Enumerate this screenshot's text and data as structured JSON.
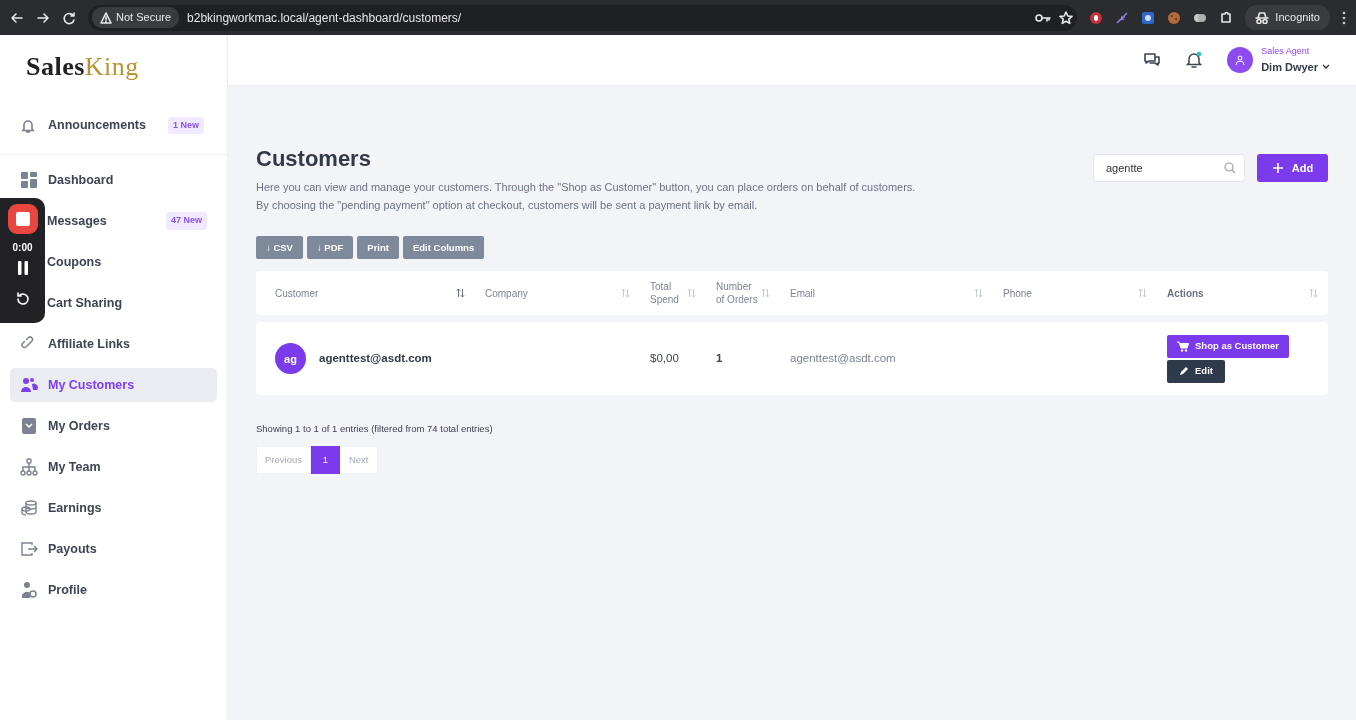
{
  "browser": {
    "security": "Not Secure",
    "url": "b2bkingworkmac.local/agent-dashboard/customers/",
    "profile": "Incognito"
  },
  "recorder": {
    "time": "0:00"
  },
  "sidebar": {
    "logo_left": "Sales",
    "logo_right": "King",
    "announcement": {
      "label": "Announcements",
      "badge": "1 New"
    },
    "items": [
      {
        "label": "Dashboard",
        "selected": false
      },
      {
        "label": "Messages",
        "selected": false,
        "badge": "47 New"
      },
      {
        "label": "Coupons",
        "selected": false
      },
      {
        "label": "Cart Sharing",
        "selected": false
      },
      {
        "label": "Affiliate Links",
        "selected": false
      },
      {
        "label": "My Customers",
        "selected": true
      },
      {
        "label": "My Orders",
        "selected": false
      },
      {
        "label": "My Team",
        "selected": false
      },
      {
        "label": "Earnings",
        "selected": false
      },
      {
        "label": "Payouts",
        "selected": false
      },
      {
        "label": "Profile",
        "selected": false
      }
    ]
  },
  "header": {
    "role": "Sales Agent",
    "user": "Dim Dwyer",
    "unread_notifications": true
  },
  "page": {
    "title": "Customers",
    "description_lines": [
      "Here you can view and manage your customers. Through the \"Shop as Customer\" button, you can place orders on behalf of customers.",
      "By choosing the \"pending payment\" option at checkout, customers will be sent a payment link by email."
    ],
    "search": {
      "value": "agentte"
    },
    "add_button": "Add",
    "export_buttons": [
      "↓ CSV",
      "↓ PDF",
      "Print",
      "Edit Columns"
    ]
  },
  "table": {
    "columns": [
      "Customer",
      "Company",
      "Total Spend",
      "Number of Orders",
      "Email",
      "Phone",
      "Actions"
    ],
    "rows": [
      {
        "initials": "ag",
        "customer": "agenttest@asdt.com",
        "total_spend": "$0,00",
        "orders": "1",
        "email": "agenttest@asdt.com",
        "actions": [
          "Shop as Customer",
          "Edit"
        ]
      }
    ]
  },
  "footer": {
    "info": "Showing 1 to 1 of 1 entries (filtered from 74 total entries)",
    "pages": [
      {
        "label": "Previous",
        "selected": false,
        "disabled": true
      },
      {
        "label": "1",
        "selected": true,
        "disabled": false
      },
      {
        "label": "Next",
        "selected": false,
        "disabled": true
      }
    ]
  }
}
